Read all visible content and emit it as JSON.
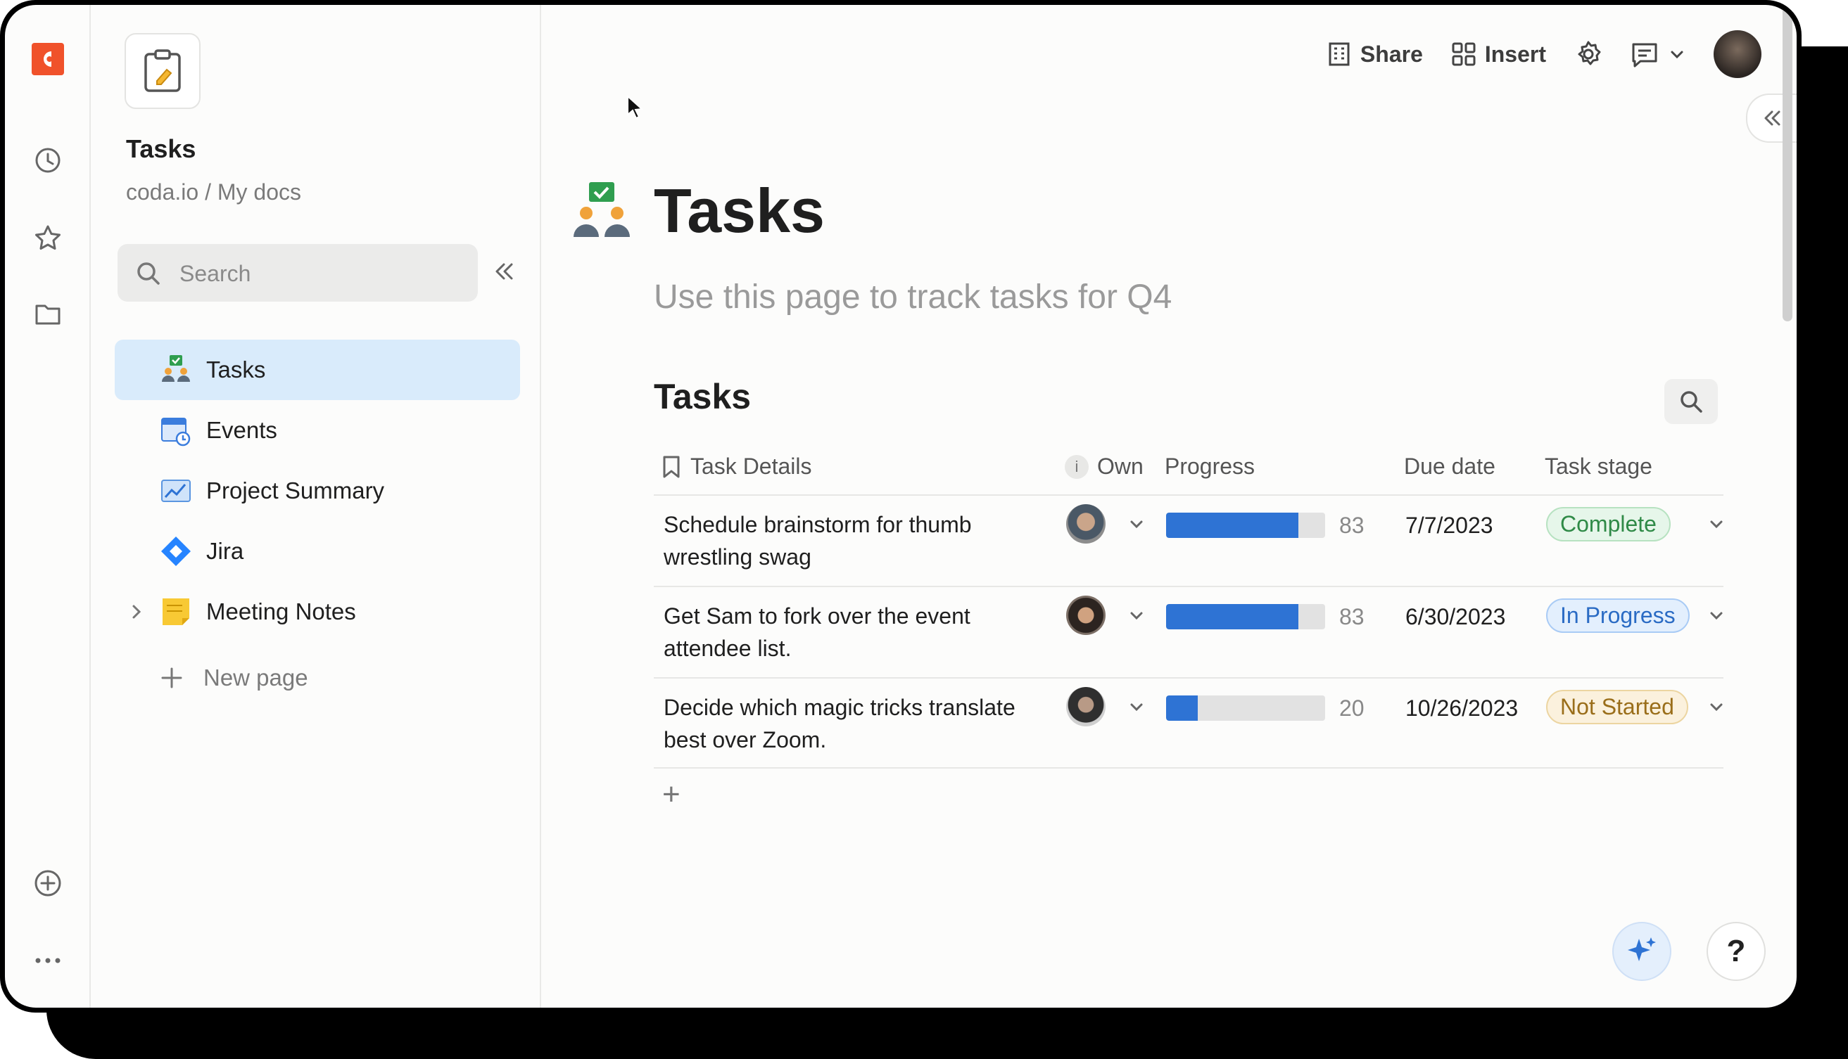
{
  "sidebar": {
    "doc_title": "Tasks",
    "breadcrumb": "coda.io / My docs",
    "search_placeholder": "Search",
    "pages": [
      {
        "label": "Tasks",
        "icon": "people-check-icon",
        "active": true
      },
      {
        "label": "Events",
        "icon": "calendar-clock-icon"
      },
      {
        "label": "Project Summary",
        "icon": "chart-icon"
      },
      {
        "label": "Jira",
        "icon": "jira-icon"
      },
      {
        "label": "Meeting Notes",
        "icon": "sticky-note-icon"
      }
    ],
    "new_page": "New page"
  },
  "topbar": {
    "share": "Share",
    "insert": "Insert"
  },
  "page": {
    "title": "Tasks",
    "subtitle": "Use this page to track tasks for Q4"
  },
  "table": {
    "title": "Tasks",
    "columns": {
      "task": "Task Details",
      "info": "i",
      "owner": "Own",
      "progress": "Progress",
      "due": "Due date",
      "stage": "Task stage"
    },
    "rows": [
      {
        "task_line1": "Schedule brainstorm for thumb",
        "task_line2": "wrestling swag",
        "progress": 83,
        "progress_label": "83",
        "due": "7/7/2023",
        "stage": "Complete"
      },
      {
        "task_line1": "Get Sam to fork over the event",
        "task_line2": "attendee list.",
        "progress": 83,
        "progress_label": "83",
        "due": "6/30/2023",
        "stage": "In Progress"
      },
      {
        "task_line1": "Decide which magic tricks translate",
        "task_line2": "best over Zoom.",
        "progress": 20,
        "progress_label": "20",
        "due": "10/26/2023",
        "stage": "Not Started"
      }
    ],
    "add_row": "+"
  },
  "help": "?",
  "colors": {
    "brand": "#f0522b",
    "accent": "#2e73d4",
    "complete": "#2f8a47",
    "in_progress": "#2a6bc4",
    "not_started": "#9a6e1a"
  }
}
